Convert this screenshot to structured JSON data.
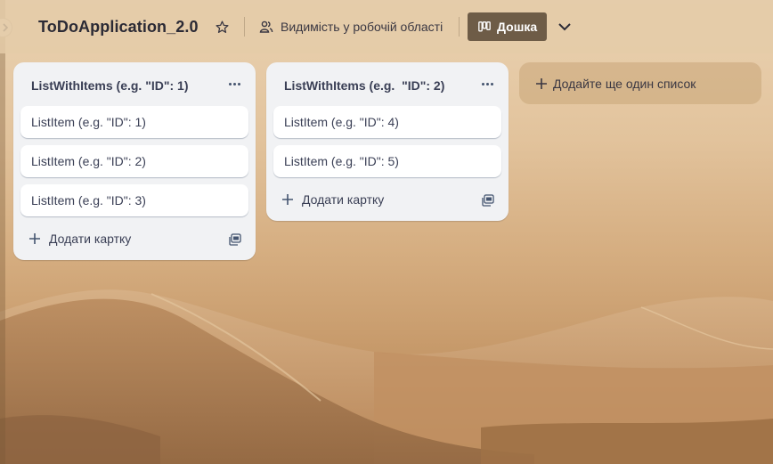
{
  "header": {
    "board_title": "ToDoApplication_2.0",
    "visibility_label": "Видимість у робочій області",
    "view_button_label": "Дошка"
  },
  "lists": [
    {
      "title": "ListWithItems (e.g. \"ID\": 1)",
      "cards": [
        "ListItem (e.g. \"ID\": 1)",
        "ListItem (e.g. \"ID\": 2)",
        "ListItem (e.g. \"ID\": 3)"
      ],
      "add_card_label": "Додати картку"
    },
    {
      "title": "ListWithItems (e.g.  \"ID\": 2)",
      "cards": [
        "ListItem (e.g. \"ID\": 4)",
        "ListItem (e.g. \"ID\": 5)"
      ],
      "add_card_label": "Додати картку"
    }
  ],
  "add_list_label": "Додайте ще один список",
  "colors": {
    "view_button_bg": "#6e5c47",
    "list_bg": "#f1f2f4",
    "text": "#3a3f55"
  },
  "icons": {
    "expand": "chevron-right-icon",
    "star": "star-icon",
    "visibility": "people-icon",
    "board": "board-icon",
    "chevron": "chevron-down-icon",
    "more": "more-icon",
    "plus": "plus-icon",
    "template": "template-icon"
  }
}
